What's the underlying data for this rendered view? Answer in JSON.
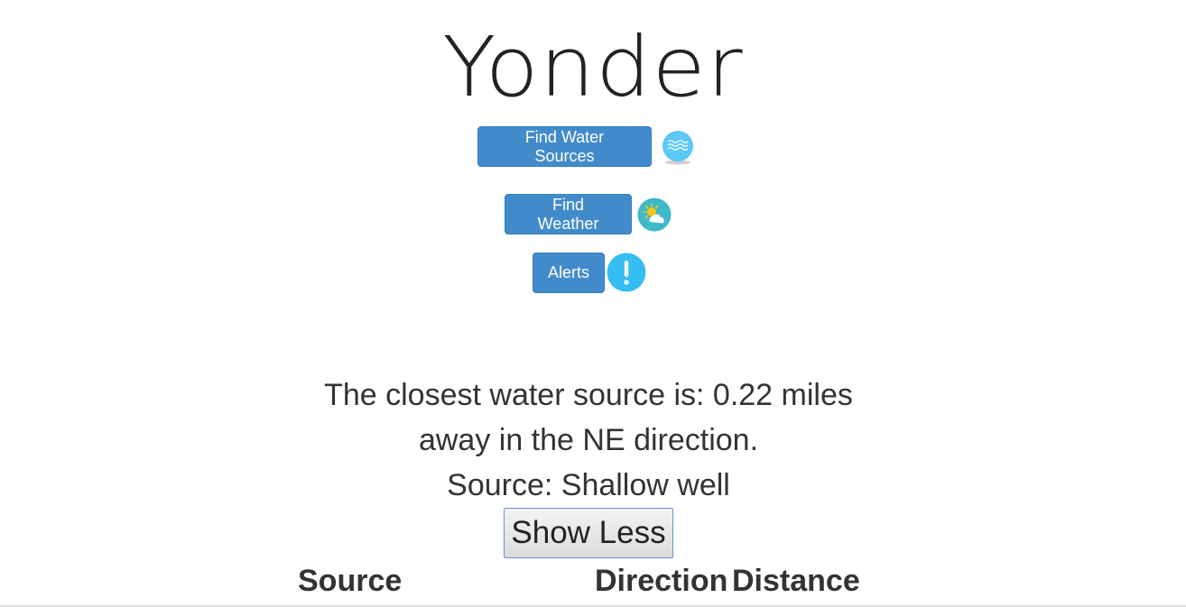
{
  "app": {
    "logo_text": "Yonder"
  },
  "actions": {
    "find_water_label": "Find Water Sources",
    "find_water_icon": "water-waves-icon",
    "find_weather_label": "Find Weather",
    "find_weather_icon": "sun-cloud-icon",
    "alerts_label": "Alerts",
    "alerts_icon": "exclamation-icon"
  },
  "result": {
    "line1": "The closest water source is: 0.22 miles",
    "line2": "away in the NE direction.",
    "line3": "Source: Shallow well",
    "toggle_label": "Show Less"
  },
  "table": {
    "columns": [
      "Source",
      "Direction",
      "Distance"
    ]
  },
  "colors": {
    "primary_button": "#428bca",
    "water_icon": "#5bc8f5",
    "weather_icon_bg": "#3fb8c8",
    "sun": "#f5c518",
    "alert_icon": "#35bdf2"
  }
}
